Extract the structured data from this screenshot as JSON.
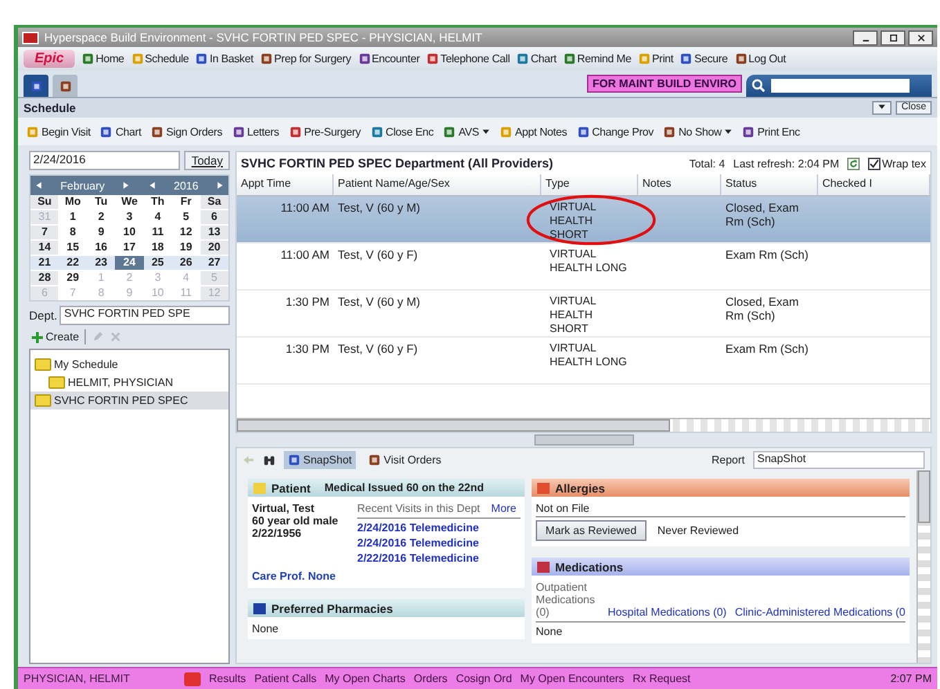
{
  "window": {
    "title": "Hyperspace Build Environment - SVHC FORTIN PED SPEC - PHYSICIAN, HELMIT"
  },
  "toolbar": {
    "logo": "Epic",
    "items": [
      "Home",
      "Schedule",
      "In Basket",
      "Prep for Surgery",
      "Encounter",
      "Telephone Call",
      "Chart",
      "Remind Me",
      "Print",
      "Secure",
      "Log Out"
    ]
  },
  "activity_tabs": [
    {
      "selected": true
    },
    {
      "selected": false
    }
  ],
  "environment_badge": "FOR MAINT BUILD ENVIRO",
  "schedule": {
    "title": "Schedule",
    "close_button": "Close",
    "actions": [
      {
        "label": "Begin Visit",
        "menu": false
      },
      {
        "label": "Chart",
        "menu": false
      },
      {
        "label": "Sign Orders",
        "menu": false
      },
      {
        "label": "Letters",
        "menu": false
      },
      {
        "label": "Pre-Surgery",
        "menu": false
      },
      {
        "label": "Close Enc",
        "menu": false
      },
      {
        "label": "AVS",
        "menu": true
      },
      {
        "label": "Appt Notes",
        "menu": false
      },
      {
        "label": "Change Prov",
        "menu": false
      },
      {
        "label": "No Show",
        "menu": true
      },
      {
        "label": "Print Enc",
        "menu": false
      }
    ]
  },
  "calendar": {
    "date": "2/24/2016",
    "today_button": "Today",
    "month": "February",
    "year": "2016",
    "weekdays": [
      "Su",
      "Mo",
      "Tu",
      "We",
      "Th",
      "Fr",
      "Sa"
    ],
    "weeks": [
      {
        "current": false,
        "days": [
          {
            "day": "31",
            "muted": true,
            "selected": false
          },
          {
            "day": "1",
            "muted": false,
            "selected": false
          },
          {
            "day": "2",
            "muted": false,
            "selected": false
          },
          {
            "day": "3",
            "muted": false,
            "selected": false
          },
          {
            "day": "4",
            "muted": false,
            "selected": false
          },
          {
            "day": "5",
            "muted": false,
            "selected": false
          },
          {
            "day": "6",
            "muted": false,
            "selected": false
          }
        ]
      },
      {
        "current": false,
        "days": [
          {
            "day": "7",
            "muted": false,
            "selected": false
          },
          {
            "day": "8",
            "muted": false,
            "selected": false
          },
          {
            "day": "9",
            "muted": false,
            "selected": false
          },
          {
            "day": "10",
            "muted": false,
            "selected": false
          },
          {
            "day": "11",
            "muted": false,
            "selected": false
          },
          {
            "day": "12",
            "muted": false,
            "selected": false
          },
          {
            "day": "13",
            "muted": false,
            "selected": false
          }
        ]
      },
      {
        "current": false,
        "days": [
          {
            "day": "14",
            "muted": false,
            "selected": false
          },
          {
            "day": "15",
            "muted": false,
            "selected": false
          },
          {
            "day": "16",
            "muted": false,
            "selected": false
          },
          {
            "day": "17",
            "muted": false,
            "selected": false
          },
          {
            "day": "18",
            "muted": false,
            "selected": false
          },
          {
            "day": "19",
            "muted": false,
            "selected": false
          },
          {
            "day": "20",
            "muted": false,
            "selected": false
          }
        ]
      },
      {
        "current": true,
        "days": [
          {
            "day": "21",
            "muted": false,
            "selected": false
          },
          {
            "day": "22",
            "muted": false,
            "selected": false
          },
          {
            "day": "23",
            "muted": false,
            "selected": false
          },
          {
            "day": "24",
            "muted": false,
            "selected": true
          },
          {
            "day": "25",
            "muted": false,
            "selected": false
          },
          {
            "day": "26",
            "muted": false,
            "selected": false
          },
          {
            "day": "27",
            "muted": false,
            "selected": false
          }
        ]
      },
      {
        "current": false,
        "days": [
          {
            "day": "28",
            "muted": false,
            "selected": false
          },
          {
            "day": "29",
            "muted": false,
            "selected": false
          },
          {
            "day": "1",
            "muted": true,
            "selected": false
          },
          {
            "day": "2",
            "muted": true,
            "selected": false
          },
          {
            "day": "3",
            "muted": true,
            "selected": false
          },
          {
            "day": "4",
            "muted": true,
            "selected": false
          },
          {
            "day": "5",
            "muted": true,
            "selected": false
          }
        ]
      },
      {
        "current": false,
        "days": [
          {
            "day": "6",
            "muted": true,
            "selected": false
          },
          {
            "day": "7",
            "muted": true,
            "selected": false
          },
          {
            "day": "8",
            "muted": true,
            "selected": false
          },
          {
            "day": "9",
            "muted": true,
            "selected": false
          },
          {
            "day": "10",
            "muted": true,
            "selected": false
          },
          {
            "day": "11",
            "muted": true,
            "selected": false
          },
          {
            "day": "12",
            "muted": true,
            "selected": false
          }
        ]
      }
    ]
  },
  "department": {
    "label": "Dept.",
    "value": "SVHC FORTIN PED SPE"
  },
  "create_button": "Create",
  "tree": [
    {
      "label": "My Schedule",
      "selected": false,
      "children": [
        {
          "label": "HELMIT, PHYSICIAN",
          "selected": false
        }
      ]
    },
    {
      "label": "SVHC FORTIN PED SPEC",
      "selected": true
    }
  ],
  "appointments": {
    "title": "SVHC FORTIN PED SPEC Department (All Providers)",
    "total": "Total: 4",
    "last_refresh": "Last refresh: 2:04 PM",
    "wrap_text": {
      "label": "Wrap tex",
      "checked": true
    },
    "columns": [
      "Appt Time",
      "Patient Name/Age/Sex",
      "Type",
      "Notes",
      "Status",
      "Checked I"
    ],
    "rows": [
      {
        "time": "11:00 AM",
        "patient": "Test, V (60 y M)",
        "type": "VIRTUAL HEALTH SHORT",
        "status": "Closed, Exam Rm (Sch)",
        "selected": true,
        "circled": true
      },
      {
        "time": "11:00 AM",
        "patient": "Test, V (60 y F)",
        "type": "VIRTUAL HEALTH LONG",
        "status": "Exam Rm (Sch)",
        "selected": false,
        "circled": false
      },
      {
        "time": "1:30 PM",
        "patient": "Test, V (60 y M)",
        "type": "VIRTUAL HEALTH SHORT",
        "status": "Closed, Exam Rm (Sch)",
        "selected": false,
        "circled": false
      },
      {
        "time": "1:30 PM",
        "patient": "Test, V (60 y F)",
        "type": "VIRTUAL HEALTH LONG",
        "status": "Exam Rm (Sch)",
        "selected": false,
        "circled": false
      }
    ]
  },
  "activity": {
    "tabs": [
      {
        "label": "SnapShot",
        "selected": true
      },
      {
        "label": "Visit Orders",
        "selected": false
      }
    ],
    "report_label": "Report",
    "report_value": "SnapShot"
  },
  "patient": {
    "title": "Patient",
    "alert": "Medical Issued 60 on the 22nd",
    "lines": [
      "Virtual, Test",
      "60 year old male",
      "2/22/1956"
    ],
    "recent_visits": "Recent Visits in this Dept",
    "more": "More",
    "visits": [
      "2/24/2016 Telemedicine",
      "2/24/2016 Telemedicine",
      "2/22/2016 Telemedicine"
    ],
    "care": "Care Prof. None"
  },
  "pharmacies": {
    "title": "Preferred Pharmacies",
    "body": "None"
  },
  "allergies": {
    "title": "Allergies",
    "body": "Not on File",
    "button": "Mark as Reviewed",
    "review": "Never Reviewed"
  },
  "medications": {
    "title": "Medications",
    "outpatient": "Outpatient Medications (0)",
    "links": [
      "Hospital Medications (0)",
      "Clinic-Administered Medications (0"
    ],
    "body": "None"
  },
  "status_bar": {
    "user": "PHYSICIAN, HELMIT",
    "links": [
      "Results",
      "Patient Calls",
      "My Open Charts",
      "Orders",
      "Cosign Ord",
      "My Open Encounters",
      "Rx Request"
    ],
    "time": "2:07 PM"
  }
}
